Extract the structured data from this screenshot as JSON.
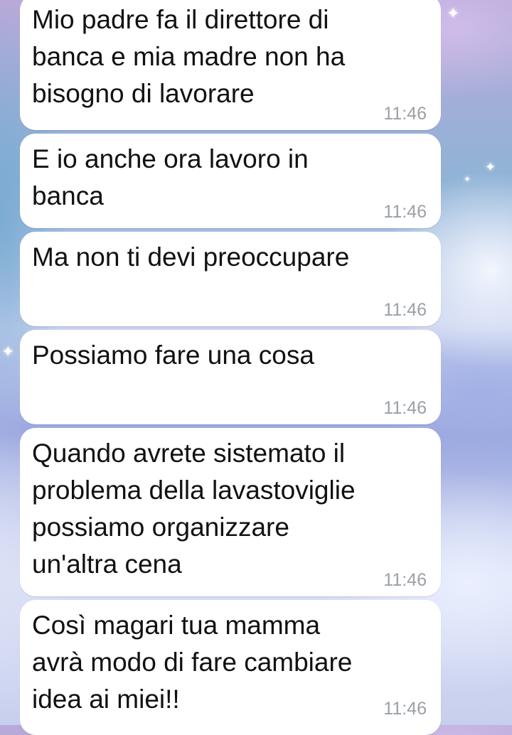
{
  "messages": [
    {
      "text": "Mio padre fa il direttore di\nbanca e mia madre non ha\nbisogno di lavorare",
      "time": "11:46"
    },
    {
      "text": "E io anche ora lavoro in\nbanca",
      "time": "11:46"
    },
    {
      "text": "Ma non ti devi preoccupare",
      "time": "11:46"
    },
    {
      "text": "Possiamo fare una cosa",
      "time": "11:46"
    },
    {
      "text": "Quando avrete sistemato il\nproblema della lavastoviglie\npossiamo organizzare\nun'altra cena",
      "time": "11:46"
    },
    {
      "text": "Così magari tua mamma\navrà modo di fare cambiare\nidea ai miei!!",
      "time": "11:46"
    }
  ],
  "colors": {
    "bubble": "#ffffff",
    "text": "#111111",
    "timestamp": "#9aa0a6"
  },
  "icons": [
    "sparkle-icon"
  ]
}
